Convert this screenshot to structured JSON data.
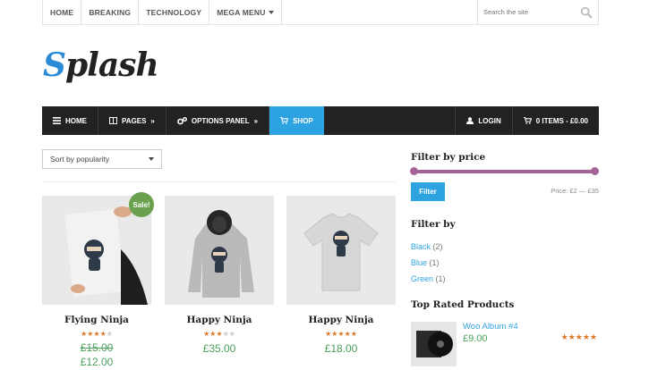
{
  "topnav": {
    "items": [
      "HOME",
      "BREAKING",
      "TECHNOLOGY",
      "MEGA MENU"
    ],
    "search_placeholder": "Search the site"
  },
  "logo": {
    "first_letter": "S",
    "rest": "plash"
  },
  "mainnav": {
    "left": [
      {
        "label": "HOME",
        "icon": "bars-icon"
      },
      {
        "label": "PAGES",
        "icon": "columns-icon",
        "arrow": "»"
      },
      {
        "label": "OPTIONS PANEL",
        "icon": "cogs-icon",
        "arrow": "»"
      },
      {
        "label": "SHOP",
        "icon": "cart-icon",
        "active": true
      }
    ],
    "right": [
      {
        "label": "LOGIN",
        "icon": "user-icon"
      },
      {
        "label": "0 ITEMS - £0.00",
        "icon": "cart-icon"
      }
    ]
  },
  "sort": {
    "selected": "Sort by popularity"
  },
  "products": [
    {
      "name": "Flying Ninja",
      "rating": 4,
      "old_price": "£15.00",
      "price": "£12.00",
      "sale_badge": "Sale!"
    },
    {
      "name": "Happy Ninja",
      "rating": 3,
      "price": "£35.00"
    },
    {
      "name": "Happy Ninja",
      "rating": 5,
      "price": "£18.00"
    }
  ],
  "sidebar": {
    "price_title": "Filter by price",
    "filter_button": "Filter",
    "price_range": "Price: £2 — £35",
    "filter_by_title": "Filter by",
    "filters": [
      {
        "label": "Black",
        "count": "(2)"
      },
      {
        "label": "Blue",
        "count": "(1)"
      },
      {
        "label": "Green",
        "count": "(1)"
      }
    ],
    "top_rated_title": "Top Rated Products",
    "top_rated": [
      {
        "name": "Woo Album #4",
        "price": "£9.00",
        "rating": 5
      }
    ]
  },
  "colors": {
    "accent": "#2ea3e1",
    "price_green": "#4b9f5a",
    "slider": "#a46497",
    "star": "#d9792a",
    "nav_dark": "#222222"
  }
}
